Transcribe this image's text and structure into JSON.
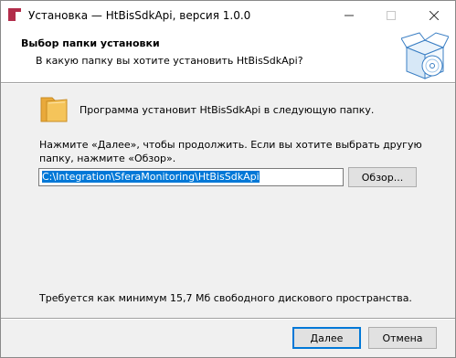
{
  "window": {
    "title": "Установка — HtBisSdkApi, версия 1.0.0",
    "icons": {
      "app": "installer-app-icon",
      "minimize": "minimize-icon",
      "maximize": "maximize-icon",
      "close": "close-icon"
    }
  },
  "header": {
    "title": "Выбор папки установки",
    "subtitle": "В какую папку вы хотите установить HtBisSdkApi?",
    "image_icon": "installer-box-icon"
  },
  "body": {
    "folder_icon": "folder-icon",
    "intro": "Программа установит HtBisSdkApi в следующую папку.",
    "instructions": "Нажмите «Далее», чтобы продолжить. Если вы хотите выбрать другую папку, нажмите «Обзор».",
    "path_value": "C:\\Integration\\SferaMonitoring\\HtBisSdkApi",
    "browse_label": "Обзор...",
    "space_required": "Требуется как минимум 15,7 Мб свободного дискового пространства."
  },
  "footer": {
    "next_label": "Далее",
    "cancel_label": "Отмена"
  },
  "colors": {
    "accent": "#0078d7",
    "app_icon": "#b22d4a",
    "folder": "#f5c45a"
  }
}
